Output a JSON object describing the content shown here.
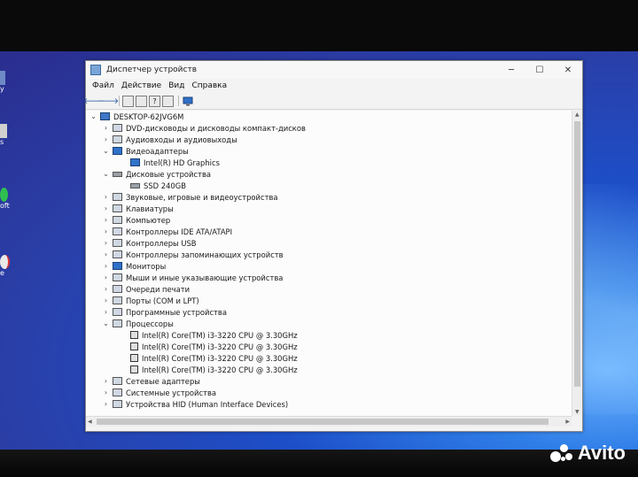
{
  "window": {
    "title": "Диспетчер устройств",
    "controls": {
      "minimize": "─",
      "maximize": "☐",
      "close": "✕"
    }
  },
  "menu": [
    "Файл",
    "Действие",
    "Вид",
    "Справка"
  ],
  "toolbar": {
    "back": "🡐",
    "forward": "🡒",
    "help": "?"
  },
  "tree": {
    "root": "DESKTOP-62JVG6M",
    "items": [
      {
        "label": "DVD-дисководы и дисководы компакт-дисков",
        "expanded": false,
        "level": 1
      },
      {
        "label": "Аудиовходы и аудиовыходы",
        "expanded": false,
        "level": 1
      },
      {
        "label": "Видеоадаптеры",
        "expanded": true,
        "level": 1
      },
      {
        "label": "Intel(R) HD Graphics",
        "level": 2
      },
      {
        "label": "Дисковые устройства",
        "expanded": true,
        "level": 1
      },
      {
        "label": "SSD 240GB",
        "level": 2
      },
      {
        "label": "Звуковые, игровые и видеоустройства",
        "expanded": false,
        "level": 1
      },
      {
        "label": "Клавиатуры",
        "expanded": false,
        "level": 1
      },
      {
        "label": "Компьютер",
        "expanded": false,
        "level": 1
      },
      {
        "label": "Контроллеры IDE ATA/ATAPI",
        "expanded": false,
        "level": 1
      },
      {
        "label": "Контроллеры USB",
        "expanded": false,
        "level": 1
      },
      {
        "label": "Контроллеры запоминающих устройств",
        "expanded": false,
        "level": 1
      },
      {
        "label": "Мониторы",
        "expanded": false,
        "level": 1
      },
      {
        "label": "Мыши и иные указывающие устройства",
        "expanded": false,
        "level": 1
      },
      {
        "label": "Очереди печати",
        "expanded": false,
        "level": 1
      },
      {
        "label": "Порты (COM и LPT)",
        "expanded": false,
        "level": 1
      },
      {
        "label": "Программные устройства",
        "expanded": false,
        "level": 1
      },
      {
        "label": "Процессоры",
        "expanded": true,
        "level": 1
      },
      {
        "label": "Intel(R) Core(TM) i3-3220 CPU @ 3.30GHz",
        "level": 2
      },
      {
        "label": "Intel(R) Core(TM) i3-3220 CPU @ 3.30GHz",
        "level": 2
      },
      {
        "label": "Intel(R) Core(TM) i3-3220 CPU @ 3.30GHz",
        "level": 2
      },
      {
        "label": "Intel(R) Core(TM) i3-3220 CPU @ 3.30GHz",
        "level": 2
      },
      {
        "label": "Сетевые адаптеры",
        "expanded": false,
        "level": 1
      },
      {
        "label": "Системные устройства",
        "expanded": false,
        "level": 1
      },
      {
        "label": "Устройства HID (Human Interface Devices)",
        "expanded": false,
        "level": 1
      }
    ]
  },
  "desktop_icons": [
    "y",
    "s",
    "oft",
    "e"
  ],
  "watermark": "Avito"
}
